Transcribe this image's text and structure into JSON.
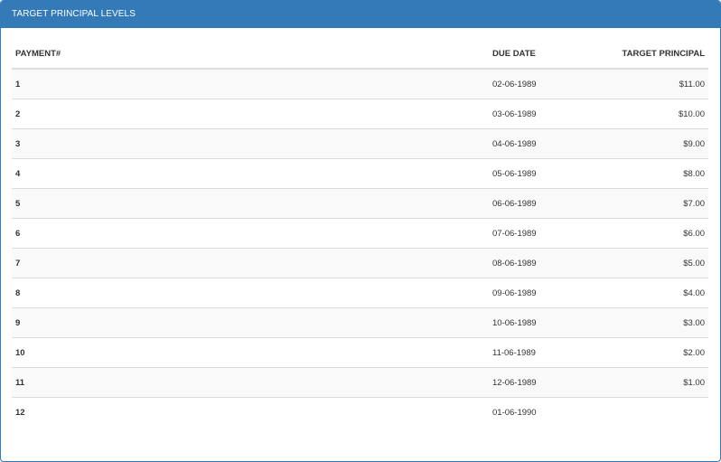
{
  "panel": {
    "title": "TARGET PRINCIPAL LEVELS"
  },
  "table": {
    "headers": [
      "PAYMENT#",
      "DUE DATE",
      "TARGET PRINCIPAL"
    ],
    "rows": [
      [
        "1",
        "02-06-1989",
        "$11.00"
      ],
      [
        "2",
        "03-06-1989",
        "$10.00"
      ],
      [
        "3",
        "04-06-1989",
        "$9.00"
      ],
      [
        "4",
        "05-06-1989",
        "$8.00"
      ],
      [
        "5",
        "06-06-1989",
        "$7.00"
      ],
      [
        "6",
        "07-06-1989",
        "$6.00"
      ],
      [
        "7",
        "08-06-1989",
        "$5.00"
      ],
      [
        "8",
        "09-06-1989",
        "$4.00"
      ],
      [
        "9",
        "10-06-1989",
        "$3.00"
      ],
      [
        "10",
        "11-06-1989",
        "$2.00"
      ],
      [
        "11",
        "12-06-1989",
        "$1.00"
      ],
      [
        "12",
        "01-06-1990",
        ""
      ]
    ]
  },
  "colors": {
    "header_bg": "#337ab7",
    "stripe_bg": "#f9f9f9",
    "border": "#dddddd"
  }
}
